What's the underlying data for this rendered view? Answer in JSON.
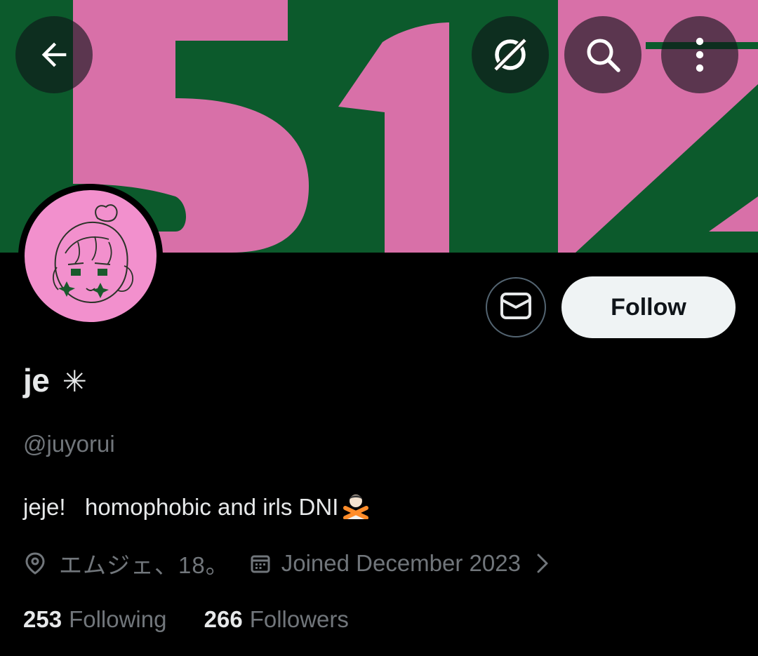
{
  "profile": {
    "display_name": "je",
    "name_symbol": "✳",
    "handle": "@juyorui",
    "bio": "jeje!   homophobic and irls DNI",
    "bio_emoji": "person-gesturing-no-emoji",
    "location": "エムジェ、18。",
    "joined": "Joined December 2023",
    "following_count": "253",
    "following_label": "Following",
    "followers_count": "266",
    "followers_label": "Followers"
  },
  "actions": {
    "follow_label": "Follow"
  },
  "icons": {
    "back": "back-arrow-icon",
    "grok": "grok-icon",
    "search": "search-icon",
    "more": "more-vertical-icon",
    "message": "mail-icon",
    "location": "location-pin-icon",
    "calendar": "calendar-icon",
    "chevron": "chevron-right-icon"
  },
  "colors": {
    "banner_green": "#0c5a2c",
    "banner_pink": "#d870a8",
    "avatar_pink": "#f290cd",
    "text_primary": "#e7e9ea",
    "text_secondary": "#71767b",
    "follow_bg": "#eff3f4"
  }
}
